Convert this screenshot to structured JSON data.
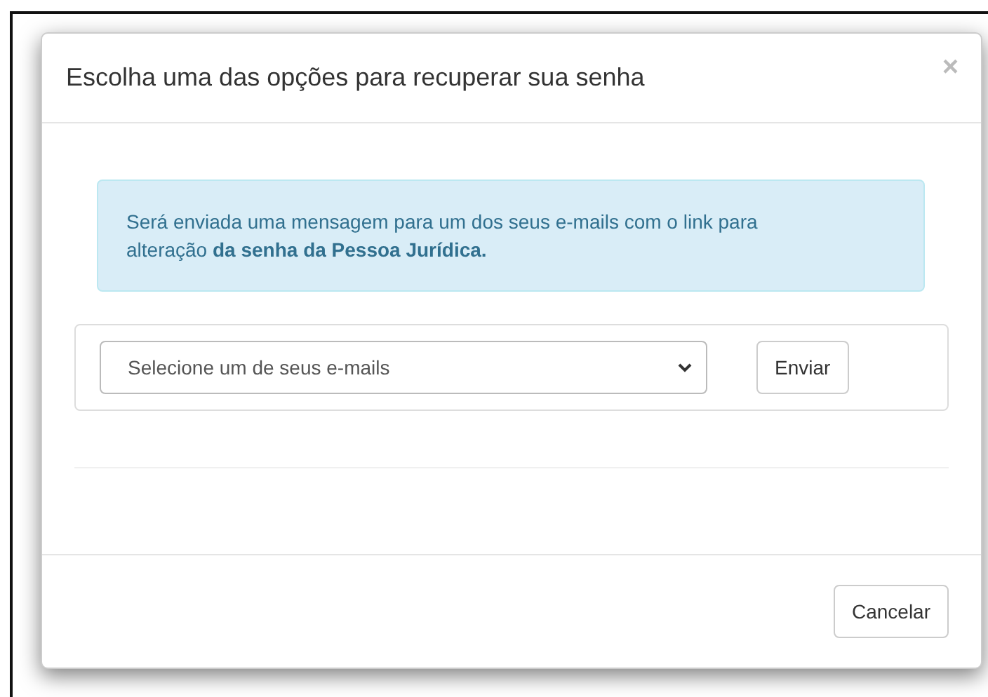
{
  "dialog": {
    "title": "Escolha uma das opções para recuperar sua senha",
    "close": "×",
    "alert": "Será enviada uma mensagem para um dos seus e-mails com o link para alteração **da senha da Pessoa Jurídica.**",
    "email_select": {
      "placeholder": "Selecione um de seus e-mails"
    },
    "send_button": "Enviar",
    "cancel_button": "Cancelar"
  }
}
